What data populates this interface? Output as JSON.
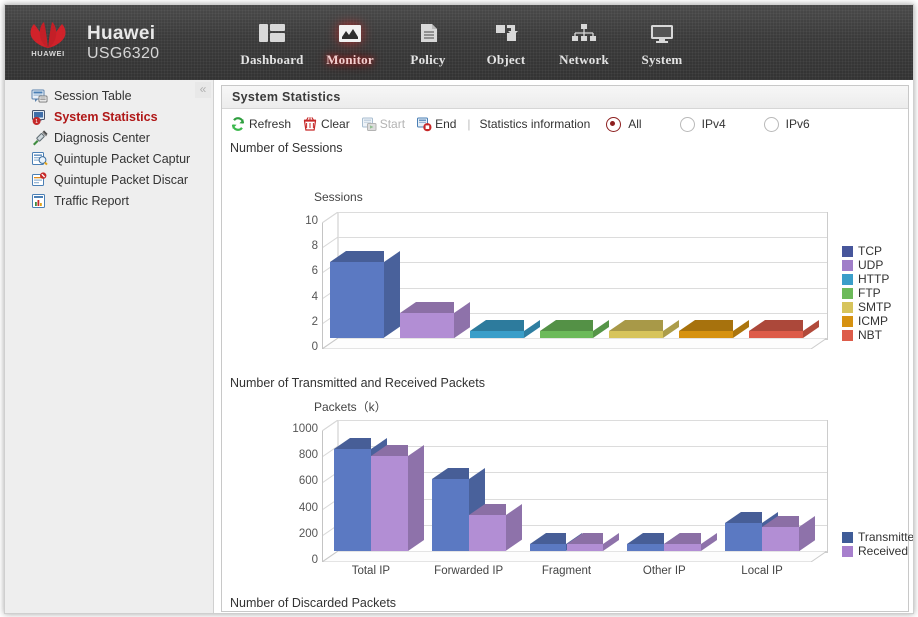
{
  "brand": {
    "name": "Huawei",
    "model": "USG6320",
    "logo_word": "HUAWEI"
  },
  "topnav": {
    "items": [
      {
        "label": "Dashboard",
        "icon": "dashboard-icon",
        "active": false
      },
      {
        "label": "Monitor",
        "icon": "monitor-chart-icon",
        "active": true
      },
      {
        "label": "Policy",
        "icon": "policy-document-icon",
        "active": false
      },
      {
        "label": "Object",
        "icon": "object-blocks-icon",
        "active": false
      },
      {
        "label": "Network",
        "icon": "network-tree-icon",
        "active": false
      },
      {
        "label": "System",
        "icon": "system-monitor-icon",
        "active": false
      }
    ]
  },
  "sidebar": {
    "collapse_label": "«",
    "items": [
      {
        "label": "Session Table",
        "icon": "session-table-icon",
        "active": false
      },
      {
        "label": "System Statistics",
        "icon": "system-statistics-icon",
        "active": true
      },
      {
        "label": "Diagnosis Center",
        "icon": "syringe-icon",
        "active": false
      },
      {
        "label": "Quintuple Packet Captur",
        "icon": "packet-capture-icon",
        "active": false
      },
      {
        "label": "Quintuple Packet Discar",
        "icon": "packet-discard-icon",
        "active": false
      },
      {
        "label": "Traffic Report",
        "icon": "traffic-report-icon",
        "active": false
      }
    ]
  },
  "panel": {
    "title": "System Statistics",
    "toolbar": {
      "refresh_label": "Refresh",
      "clear_label": "Clear",
      "start_label": "Start",
      "end_label": "End",
      "separator": "|",
      "statistics_label": "Statistics information",
      "radios": [
        {
          "label": "All",
          "checked": true
        },
        {
          "label": "IPv4",
          "checked": false
        },
        {
          "label": "IPv6",
          "checked": false
        }
      ]
    },
    "sections": {
      "sessions_label": "Number of Sessions",
      "packets_label": "Number of Transmitted and Received Packets",
      "discarded_label": "Number of Discarded Packets"
    }
  },
  "chart_data": [
    {
      "type": "bar",
      "title": "Sessions",
      "xlabel": "",
      "ylabel": "Sessions",
      "ylim": [
        0,
        10
      ],
      "yticks": [
        0,
        2,
        4,
        6,
        8,
        10
      ],
      "grid": true,
      "legend_position": "right",
      "categories": [
        "TCP",
        "UDP",
        "HTTP",
        "FTP",
        "SMTP",
        "ICMP",
        "NBT"
      ],
      "values": [
        6,
        2,
        0,
        0,
        0,
        0,
        0
      ],
      "colors": [
        "#5b79c2",
        "#b28ed4",
        "#3a9ec9",
        "#6cba5a",
        "#d7c45c",
        "#d69211",
        "#dd5c4a"
      ],
      "legend": [
        {
          "name": "TCP",
          "color": "#47569b"
        },
        {
          "name": "UDP",
          "color": "#a07ec9"
        },
        {
          "name": "HTTP",
          "color": "#3a9ec9"
        },
        {
          "name": "FTP",
          "color": "#6cba5a"
        },
        {
          "name": "SMTP",
          "color": "#d7c45c"
        },
        {
          "name": "ICMP",
          "color": "#d69211"
        },
        {
          "name": "NBT",
          "color": "#dd5c4a"
        }
      ]
    },
    {
      "type": "bar",
      "title": "Packets（k）",
      "xlabel": "",
      "ylabel": "Packets (k)",
      "ylim": [
        0,
        1000
      ],
      "yticks": [
        0,
        200,
        400,
        600,
        800,
        1000
      ],
      "grid": true,
      "legend_position": "right",
      "categories": [
        "Total IP",
        "Forwarded IP",
        "Fragment",
        "Other IP",
        "Local IP"
      ],
      "series": [
        {
          "name": "Transmitted",
          "color": "#5b79c2",
          "values": [
            780,
            550,
            0,
            5,
            215
          ]
        },
        {
          "name": "Received",
          "color": "#b28ed4",
          "values": [
            725,
            272,
            3,
            6,
            185
          ]
        }
      ],
      "legend": [
        {
          "name": "Transmitted",
          "color": "#3f5c98"
        },
        {
          "name": "Received",
          "color": "#a77fcd"
        }
      ]
    }
  ]
}
